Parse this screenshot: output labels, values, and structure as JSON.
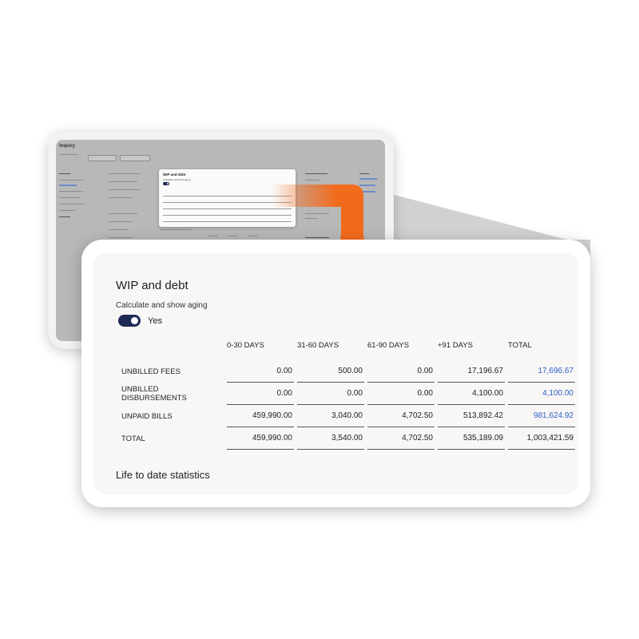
{
  "background": {
    "title": "Inquiry"
  },
  "wip": {
    "title": "WIP and debt",
    "aging_label": "Calculate and show aging",
    "toggle_state": "Yes",
    "toggle_on": true,
    "columns": [
      "",
      "0-30 DAYS",
      "31-60 DAYS",
      "61-90 DAYS",
      "+91 DAYS",
      "TOTAL"
    ],
    "rows": [
      {
        "label": "UNBILLED FEES",
        "values": [
          "0.00",
          "500.00",
          "0.00",
          "17,196.67",
          "17,696.67"
        ],
        "total_link": true
      },
      {
        "label": "UNBILLED DISBURSEMENTS",
        "values": [
          "0.00",
          "0.00",
          "0.00",
          "4,100.00",
          "4,100.00"
        ],
        "total_link": true
      },
      {
        "label": "UNPAID BILLS",
        "values": [
          "459,990.00",
          "3,040.00",
          "4,702.50",
          "513,892.42",
          "981,624.92"
        ],
        "total_link": true
      },
      {
        "label": "TOTAL",
        "values": [
          "459,990.00",
          "3,540.00",
          "4,702.50",
          "535,189.09",
          "1,003,421.59"
        ],
        "total_link": false
      }
    ]
  },
  "life_to_date": {
    "title": "Life to date statistics"
  },
  "colors": {
    "accent_orange": "#f26b1d",
    "toggle_navy": "#1e2a55",
    "link_blue": "#2f5fc4"
  }
}
